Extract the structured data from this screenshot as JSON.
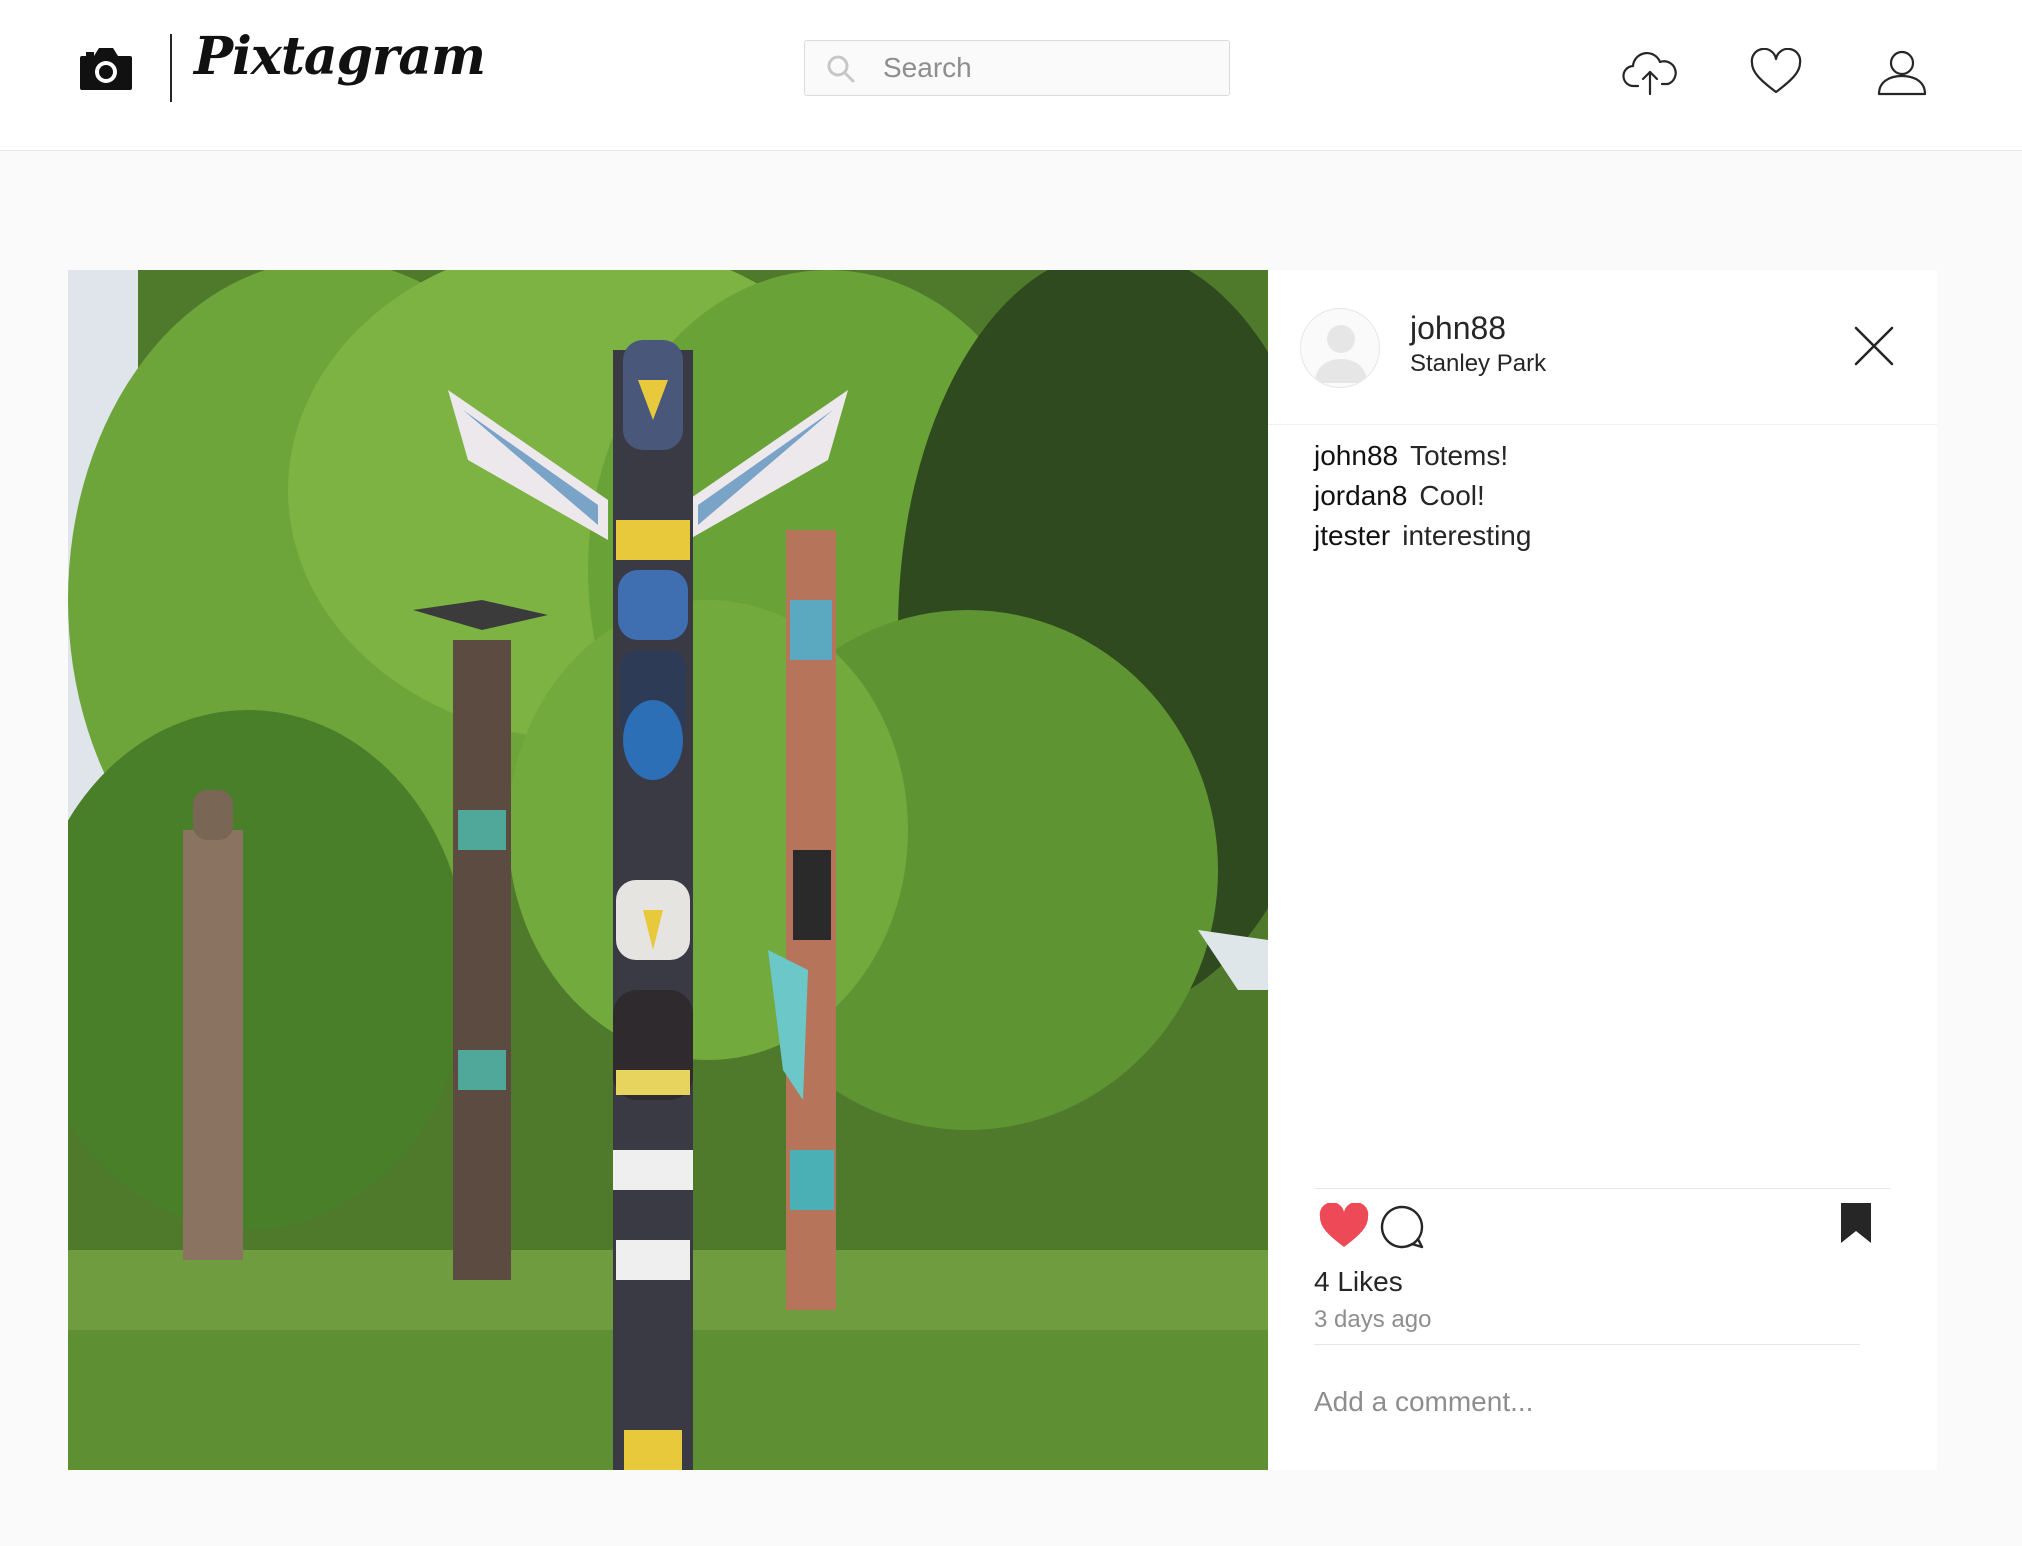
{
  "header": {
    "brand_name": "Pixtagram",
    "search_placeholder": "Search"
  },
  "post": {
    "username": "john88",
    "location": "Stanley Park",
    "comments": [
      {
        "user": "john88",
        "text": "Totems!"
      },
      {
        "user": "jordan8",
        "text": "Cool!"
      },
      {
        "user": "jtester",
        "text": "interesting"
      }
    ],
    "likes_text": "4 Likes",
    "time_ago": "3 days ago",
    "add_comment_placeholder": "Add a comment...",
    "liked": true
  },
  "colors": {
    "like_red": "#ed4956",
    "text": "#262626",
    "muted": "#8e8e8e",
    "border": "#e6e6e6"
  },
  "icons": {
    "brand": "camera-icon",
    "search": "search-icon",
    "upload": "cloud-upload-icon",
    "activity": "heart-outline-icon",
    "profile": "user-outline-icon",
    "close": "close-icon",
    "like": "heart-filled-icon",
    "comment": "comment-bubble-icon",
    "save": "bookmark-filled-icon"
  }
}
